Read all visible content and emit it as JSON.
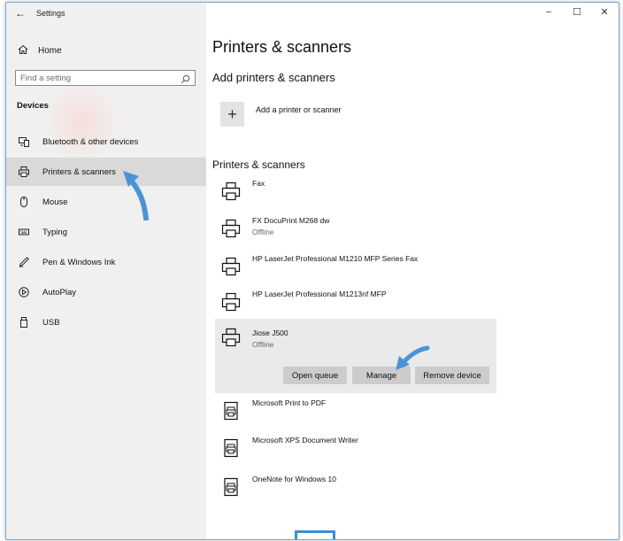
{
  "titlebar": {
    "title": "Settings",
    "back_glyph": "←",
    "minimize_glyph": "−",
    "maximize_glyph": "☐",
    "close_glyph": "✕"
  },
  "sidebar": {
    "home_label": "Home",
    "home_icon": "home-icon",
    "search": {
      "placeholder": "Find a setting"
    },
    "section_label": "Devices",
    "items": [
      {
        "label": "Bluetooth & other devices",
        "icon": "bluetooth-devices-icon",
        "selected": false
      },
      {
        "label": "Printers & scanners",
        "icon": "printer-icon",
        "selected": true
      },
      {
        "label": "Mouse",
        "icon": "mouse-icon",
        "selected": false
      },
      {
        "label": "Typing",
        "icon": "keyboard-icon",
        "selected": false
      },
      {
        "label": "Pen & Windows Ink",
        "icon": "pen-icon",
        "selected": false
      },
      {
        "label": "AutoPlay",
        "icon": "autoplay-icon",
        "selected": false
      },
      {
        "label": "USB",
        "icon": "usb-icon",
        "selected": false
      }
    ]
  },
  "main": {
    "page_title": "Printers & scanners",
    "add_section_title": "Add printers & scanners",
    "add_label": "Add a printer or scanner",
    "add_glyph": "+",
    "list_title": "Printers & scanners",
    "printers": [
      {
        "name": "Fax",
        "status": "",
        "icon": "printer-icon"
      },
      {
        "name": "FX DocuPrint M268 dw",
        "status": "Offline",
        "icon": "printer-icon"
      },
      {
        "name": "HP LaserJet Professional M1210 MFP Series Fax",
        "status": "",
        "icon": "printer-icon"
      },
      {
        "name": "HP LaserJet Professional M1213nf MFP",
        "status": "",
        "icon": "printer-icon"
      },
      {
        "name": "Jiose J500",
        "status": "Offline",
        "icon": "printer-icon",
        "selected": true
      },
      {
        "name": "Microsoft Print to PDF",
        "status": "",
        "icon": "document-printer-icon"
      },
      {
        "name": "Microsoft XPS Document Writer",
        "status": "",
        "icon": "document-printer-icon"
      },
      {
        "name": "OneNote for Windows 10",
        "status": "",
        "icon": "document-printer-icon"
      }
    ],
    "selected_actions": {
      "open_queue": "Open queue",
      "manage": "Manage",
      "remove_device": "Remove device"
    }
  },
  "colors": {
    "accent": "#3a8fd1",
    "sidebar_bg": "#f0f0f0",
    "selected_bg": "#d9d9d9"
  }
}
